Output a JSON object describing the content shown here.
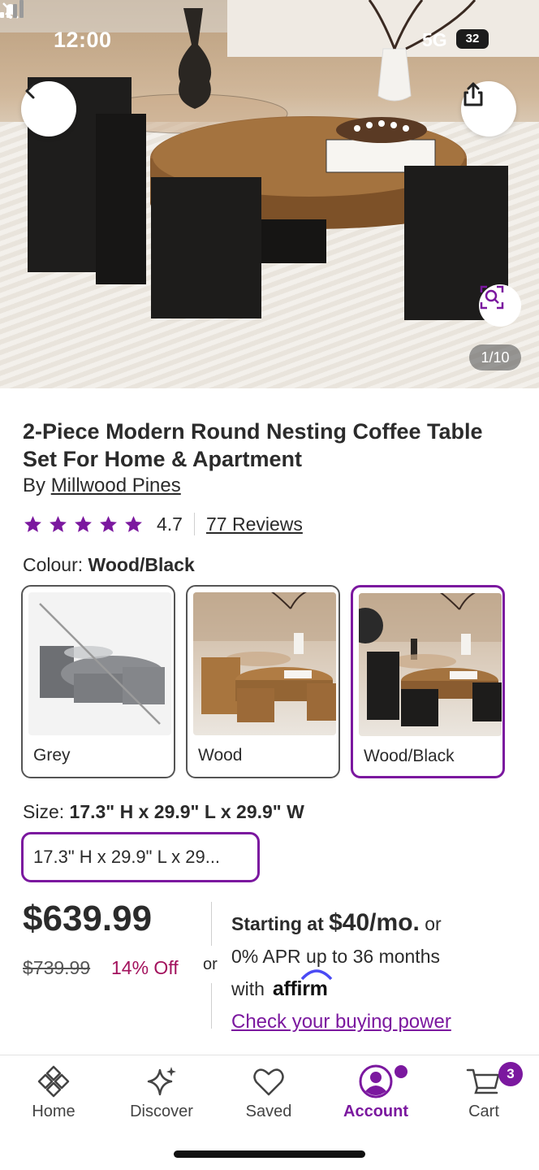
{
  "status_bar": {
    "time": "12:00",
    "network": "5G",
    "battery": "32"
  },
  "gallery": {
    "counter": "1/10"
  },
  "product": {
    "title": "2-Piece Modern Round Nesting Coffee Table Set For Home & Apartment",
    "by_prefix": "By",
    "brand": "Millwood Pines",
    "rating": "4.7",
    "stars": 5,
    "reviews_link": "77 Reviews"
  },
  "colour": {
    "label": "Colour:",
    "selected": "Wood/Black",
    "options": [
      {
        "name": "Grey",
        "unavailable": true
      },
      {
        "name": "Wood"
      },
      {
        "name": "Wood/Black",
        "selected": true
      }
    ]
  },
  "size": {
    "label": "Size:",
    "selected": "17.3\" H x 29.9\" L x 29.9\" W",
    "chip_text": "17.3\" H x 29.9\" L x 29..."
  },
  "pricing": {
    "price": "$639.99",
    "was_price": "$739.99",
    "discount": "14% Off",
    "or": "or"
  },
  "financing": {
    "starting_at": "Starting at",
    "monthly": "$40/mo.",
    "or_word": "or",
    "apr_line": "0% APR up to 36 months",
    "with_word": "with",
    "affirm": "affirm",
    "buying_power_link": "Check your buying power"
  },
  "nav": {
    "home": "Home",
    "discover": "Discover",
    "saved": "Saved",
    "account": "Account",
    "cart": "Cart",
    "cart_count": "3"
  },
  "colors": {
    "accent": "#7b189f",
    "discount": "#a3125d"
  }
}
